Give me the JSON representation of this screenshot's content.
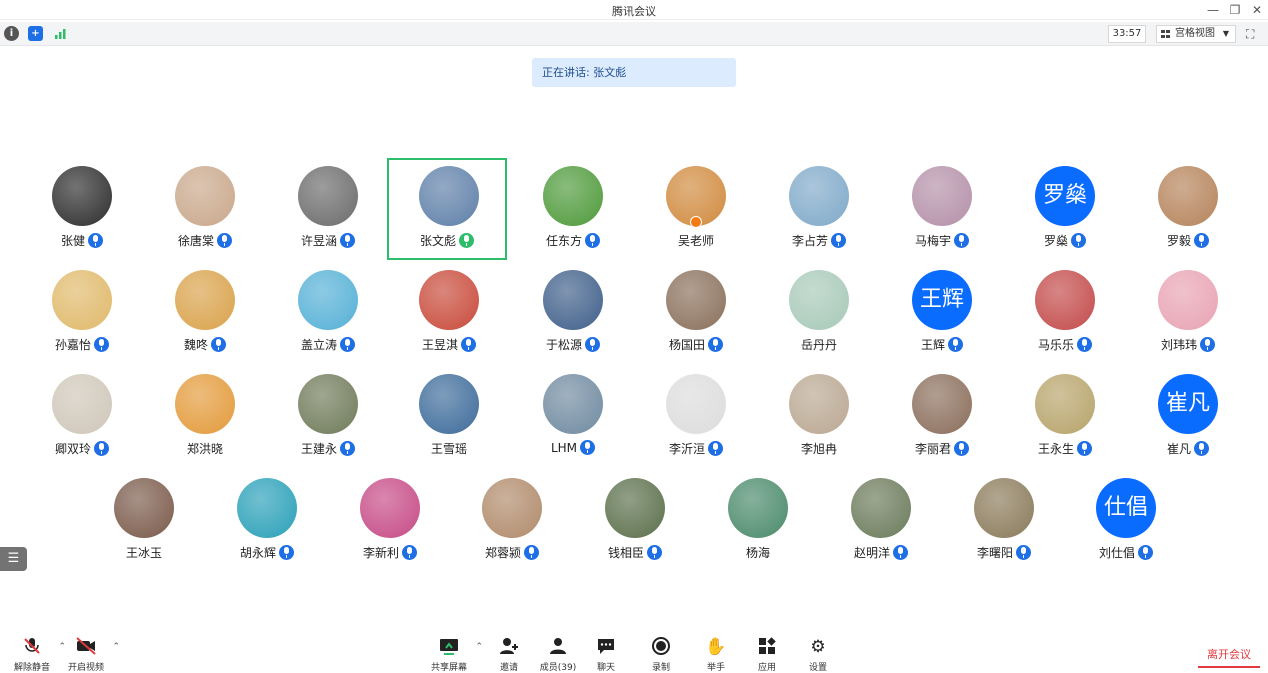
{
  "window": {
    "title": "腾讯会议"
  },
  "infobar": {
    "timer": "33:57",
    "view_label": "宫格视图"
  },
  "speaking": {
    "text": "正在讲话: 张文彪"
  },
  "participants": [
    {
      "name": "张健",
      "mic": true
    },
    {
      "name": "徐唐棠",
      "mic": true
    },
    {
      "name": "许昱涵",
      "mic": true
    },
    {
      "name": "张文彪",
      "mic": true,
      "speaking": true
    },
    {
      "name": "任东方",
      "mic": true
    },
    {
      "name": "吴老师",
      "mic": false,
      "host": true
    },
    {
      "name": "李占芳",
      "mic": true
    },
    {
      "name": "马梅宇",
      "mic": true
    },
    {
      "name": "罗燊",
      "mic": true,
      "initials": "罗燊",
      "avatar_color": "#0a6cff"
    },
    {
      "name": "罗毅",
      "mic": true
    },
    {
      "name": "孙嘉怡",
      "mic": true
    },
    {
      "name": "魏咚",
      "mic": true
    },
    {
      "name": "盖立涛",
      "mic": true
    },
    {
      "name": "王昱淇",
      "mic": true
    },
    {
      "name": "于松源",
      "mic": true
    },
    {
      "name": "杨国田",
      "mic": true
    },
    {
      "name": "岳丹丹",
      "mic": false
    },
    {
      "name": "王辉",
      "mic": true,
      "initials": "王辉",
      "avatar_color": "#0a6cff"
    },
    {
      "name": "马乐乐",
      "mic": true
    },
    {
      "name": "刘玮玮",
      "mic": true
    },
    {
      "name": "卿双玲",
      "mic": true
    },
    {
      "name": "郑洪晓",
      "mic": false
    },
    {
      "name": "王建永",
      "mic": true
    },
    {
      "name": "王雪瑶",
      "mic": false
    },
    {
      "name": "LHM",
      "mic": true
    },
    {
      "name": "李沂洹",
      "mic": true
    },
    {
      "name": "李旭冉",
      "mic": false
    },
    {
      "name": "李丽君",
      "mic": true
    },
    {
      "name": "王永生",
      "mic": true
    },
    {
      "name": "崔凡",
      "mic": true,
      "initials": "崔凡",
      "avatar_color": "#0a6cff"
    },
    {
      "name": "王冰玉",
      "mic": false
    },
    {
      "name": "胡永辉",
      "mic": true
    },
    {
      "name": "李新利",
      "mic": true
    },
    {
      "name": "郑蓉颍",
      "mic": true
    },
    {
      "name": "钱相臣",
      "mic": true
    },
    {
      "name": "杨海",
      "mic": false
    },
    {
      "name": "赵明洋",
      "mic": true
    },
    {
      "name": "李曙阳",
      "mic": true
    },
    {
      "name": "刘仕倡",
      "mic": true,
      "initials": "仕倡",
      "avatar_color": "#0a6cff"
    }
  ],
  "toolbar": {
    "mute_label": "解除静音",
    "video_label": "开启视频",
    "share_label": "共享屏幕",
    "invite_label": "邀请",
    "members_label": "成员(39)",
    "chat_label": "聊天",
    "record_label": "录制",
    "raise_hand_label": "举手",
    "apps_label": "应用",
    "settings_label": "设置",
    "leave_label": "离开会议"
  },
  "colors": {
    "accent": "#1e6fe6",
    "speaking_border": "#2ebd6b",
    "leave": "#e0393e"
  }
}
